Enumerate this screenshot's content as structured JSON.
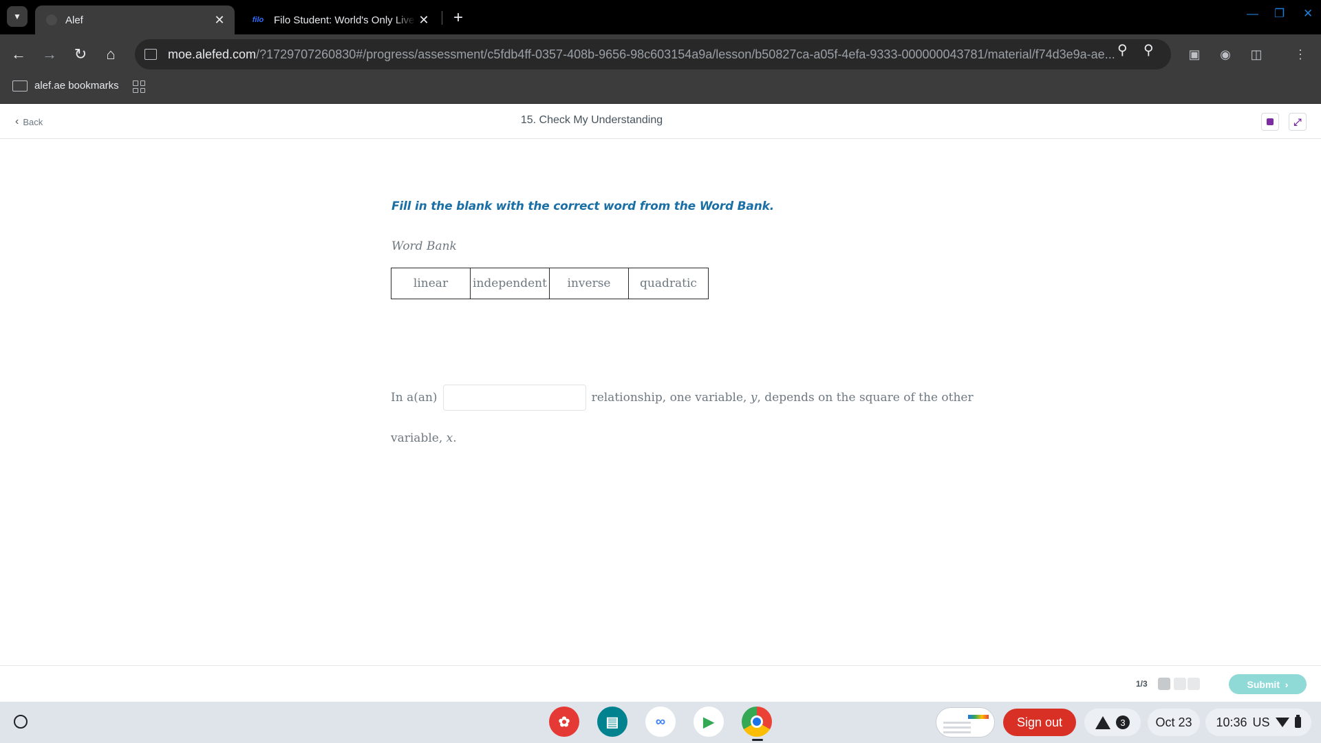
{
  "browser": {
    "tabs": [
      {
        "title": "Alef",
        "active": true
      },
      {
        "title": "Filo Student: World's Only Live Instant Tutoring",
        "favicon_text": "filo",
        "active": false
      }
    ],
    "url_host": "moe.alefed.com",
    "url_path": "/?1729707260830#/progress/assessment/c5fdb4ff-0357-408b-9656-98c603154a9a/lesson/b50827ca-a05f-4efa-9333-000000043781/material/f74d3e9a-ae...",
    "bookmark_folder": "alef.ae bookmarks"
  },
  "header": {
    "back_label": "Back",
    "title": "15. Check My Understanding"
  },
  "question": {
    "instruction": "Fill in the blank with the correct word from the Word Bank.",
    "word_bank_label": "Word Bank",
    "word_bank": [
      "linear",
      "independent",
      "inverse",
      "quadratic"
    ],
    "sentence_prefix": "In a(an)",
    "blank_value": "",
    "sentence_middle": "relationship, one variable,",
    "var_y": "y",
    "sentence_after_y": ", depends on the square of the other",
    "sentence_line2": "variable,",
    "var_x": "x",
    "sentence_end": "."
  },
  "footer": {
    "page_count": "1/3",
    "submit_label": "Submit"
  },
  "shelf": {
    "signout_label": "Sign out",
    "notification_count": "3",
    "date": "Oct 23",
    "time": "10:36",
    "locale": "US"
  }
}
